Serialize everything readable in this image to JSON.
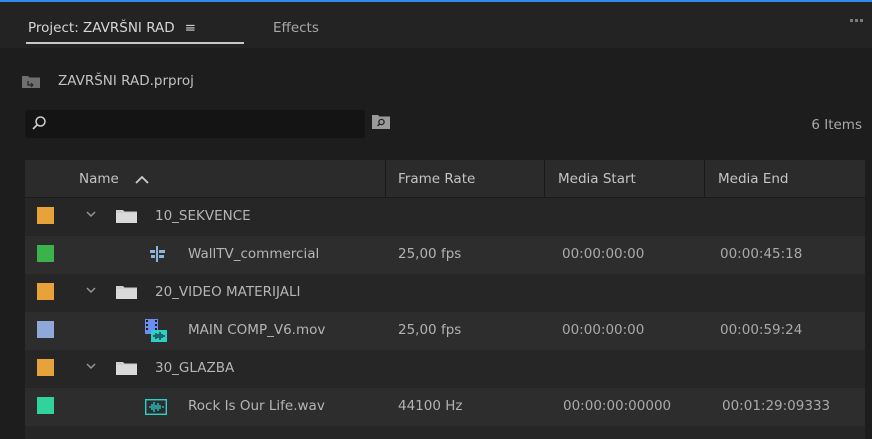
{
  "tabs": {
    "project_label": "Project: ZAVRŠNI RAD",
    "menu_glyph": "≡",
    "effects_label": "Effects"
  },
  "breadcrumb": {
    "path": "ZAVRŠNI RAD.prproj"
  },
  "search": {
    "value": "",
    "placeholder": ""
  },
  "items_count": "6 Items",
  "table": {
    "headers": {
      "name": "Name",
      "frame_rate": "Frame Rate",
      "media_start": "Media Start",
      "media_end": "Media End"
    },
    "sort": "ascending",
    "rows": [
      {
        "type": "bin",
        "label_color": "#e8a23a",
        "name": "10_SEKVENCE",
        "frame_rate": "",
        "media_start": "",
        "media_end": "",
        "icon": "folder-icon",
        "expanded": true
      },
      {
        "type": "sequence",
        "label_color": "#3cb34a",
        "name": "WallTV_commercial",
        "frame_rate": "25,00 fps",
        "media_start": "00:00:00:00",
        "media_end": "00:00:45:18",
        "icon": "sequence-icon"
      },
      {
        "type": "bin",
        "label_color": "#e8a23a",
        "name": "20_VIDEO MATERIJALI",
        "frame_rate": "",
        "media_start": "",
        "media_end": "",
        "icon": "folder-icon",
        "expanded": true
      },
      {
        "type": "video",
        "label_color": "#8fa8d8",
        "name": "MAIN COMP_V6.mov",
        "frame_rate": "25,00 fps",
        "media_start": "00:00:00:00",
        "media_end": "00:00:59:24",
        "icon": "video-clip-icon"
      },
      {
        "type": "bin",
        "label_color": "#e8a23a",
        "name": "30_GLAZBA",
        "frame_rate": "",
        "media_start": "",
        "media_end": "",
        "icon": "folder-icon",
        "expanded": true
      },
      {
        "type": "audio",
        "label_color": "#2fd39b",
        "name": "Rock Is Our Life.wav",
        "frame_rate": "44100 Hz",
        "media_start": "00:00:00:00000",
        "media_end": "00:01:29:09333",
        "icon": "audio-clip-icon"
      }
    ]
  },
  "colors": {
    "accent_blue": "#2d8ceb",
    "panel_bg": "#1d1d1d",
    "row_dark": "#262626",
    "row_light": "#2d2d2d",
    "sequence_icon": "#8fb3d9",
    "media_icon": "#6b8ef0",
    "audio_icon": "#2ad1c9"
  }
}
